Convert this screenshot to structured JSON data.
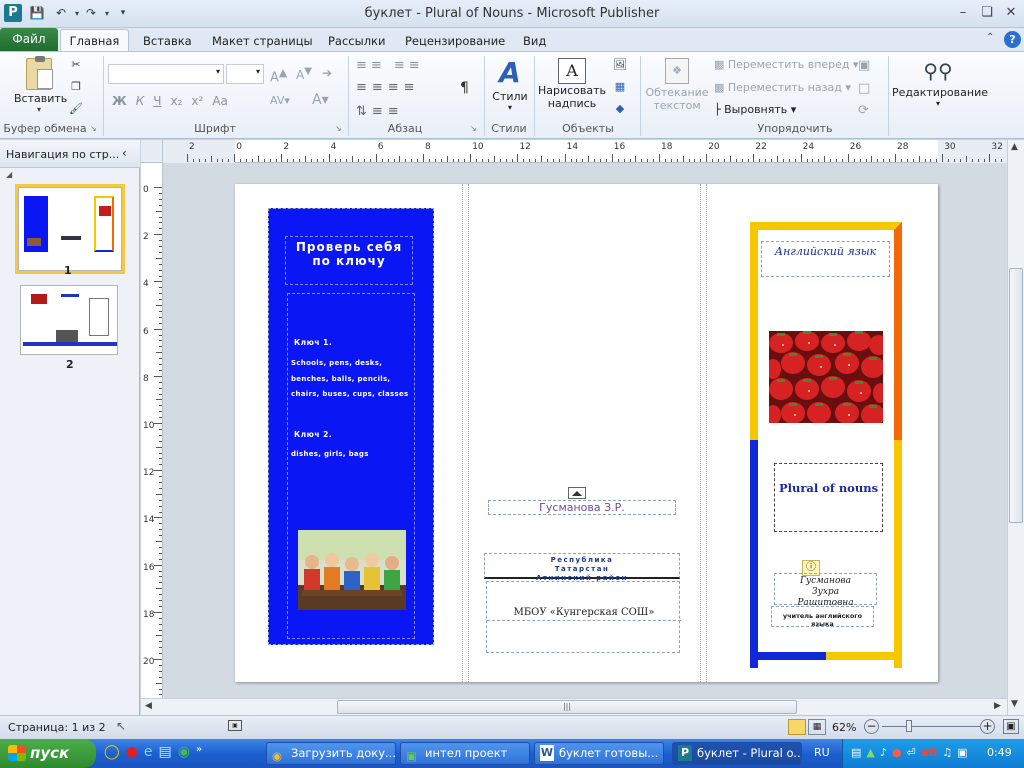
{
  "window": {
    "title": "буклет - Plural of Nouns  -  Microsoft Publisher",
    "app_icon": "P"
  },
  "tabs": [
    "Файл",
    "Главная",
    "Вставка",
    "Макет страницы",
    "Рассылки",
    "Рецензирование",
    "Вид"
  ],
  "ribbon": {
    "paste_label": "Вставить",
    "clipboard_group": "Буфер обмена",
    "font_group": "Шрифт",
    "paragraph_group": "Абзац",
    "styles_label": "Стили",
    "styles_group": "Стили",
    "draw_textbox_label_1": "Нарисовать",
    "draw_textbox_label_2": "надпись",
    "objects_group": "Объекты",
    "wrap_text_1": "Обтекание",
    "wrap_text_2": "текстом",
    "bring_forward": "Переместить вперед",
    "send_backward": "Переместить назад",
    "align": "Выровнять",
    "arrange_group": "Упорядочить",
    "editing": "Редактирование",
    "font_buttons": [
      "Ж",
      "К",
      "Ч",
      "x₂",
      "x²",
      "Aa"
    ]
  },
  "nav": {
    "title": "Навигация по стр...",
    "pages": [
      "1",
      "2"
    ]
  },
  "ruler": {
    "h_labels": [
      "2",
      "0",
      "2",
      "4",
      "6",
      "8",
      "10",
      "12",
      "14",
      "16",
      "18",
      "20",
      "22",
      "24",
      "26",
      "28",
      "30",
      "32"
    ],
    "v_labels": [
      "0",
      "2",
      "4",
      "6",
      "8",
      "10",
      "12",
      "14",
      "16",
      "18",
      "20"
    ]
  },
  "page": {
    "left_panel": {
      "heading": "Проверь себя по ключу",
      "key1_title": "Ключ 1.",
      "key1_text": "Schools, pens, desks, benches, balls, pencils, chairs, buses, cups, classes",
      "key2_title": "Ключ 2.",
      "key2_text": "dishes, girls, bags"
    },
    "middle_panel": {
      "author": "Гусманова З.Р.",
      "region": "Республика Татарстан Атнинский район",
      "school": "МБОУ «Кунгерская  СОШ»"
    },
    "right_panel": {
      "subject": "Английский язык",
      "title": "Plural of nouns",
      "author_name": "Гусманова Зухра Рашитовна",
      "author_role": "учитель английского языка"
    },
    "colors": {
      "blue_panel": "#0b16f5",
      "border_yellow": "#f5c800",
      "border_orange": "#f06a0a",
      "border_blue": "#1128d8"
    }
  },
  "status": {
    "page_info": "Страница: 1 из 2",
    "zoom": "62%"
  },
  "taskbar": {
    "start": "пуск",
    "buttons": [
      "Загрузить доку...",
      "интел проект",
      "буклет готовы...",
      "буклет - Plural o..."
    ],
    "lang": "RU",
    "clock": "0:49"
  }
}
